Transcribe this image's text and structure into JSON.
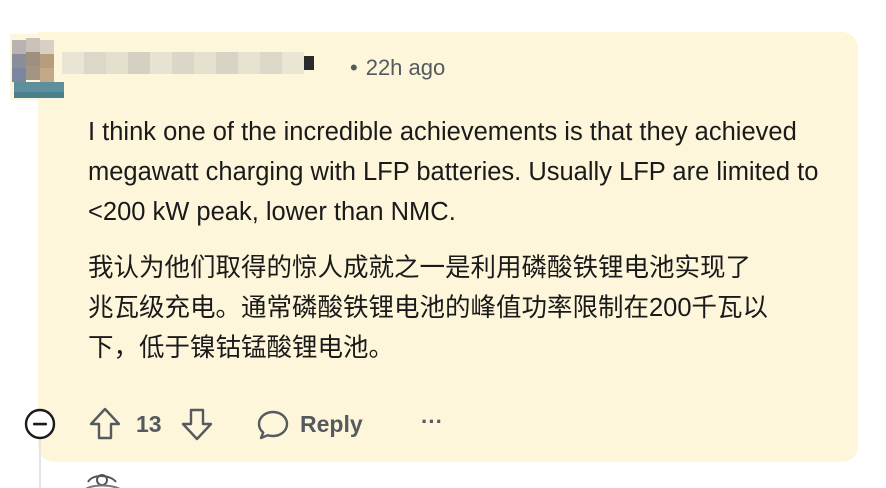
{
  "comment": {
    "timestamp": "22h ago",
    "dot": "•",
    "body_en": "I think one of the incredible achievements is that they achieved megawatt charging with LFP batteries. Usually LFP are limited to <200 kW peak, lower than NMC.",
    "body_zh_line1": "我认为他们取得的惊人成就之一是利用磷酸铁锂电池实现了",
    "body_zh_line2": "兆瓦级充电。通常磷酸铁锂电池的峰值功率限制在200千瓦以",
    "body_zh_line3": "下，低于镍钴锰酸锂电池。",
    "card_color": "#fdf6da"
  },
  "actions": {
    "vote_count": "13",
    "reply_label": "Reply",
    "more_label": "···"
  },
  "icons": {
    "collapse": "minus-circle-icon",
    "upvote": "arrow-up-icon",
    "downvote": "arrow-down-icon",
    "reply": "speech-bubble-icon",
    "more": "ellipsis-icon"
  }
}
